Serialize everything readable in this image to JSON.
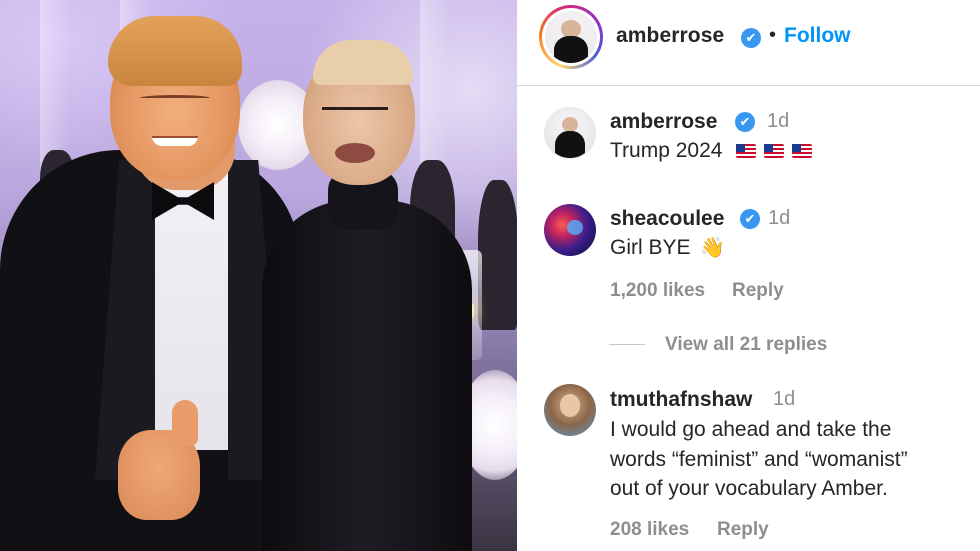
{
  "header": {
    "username": "amberrose",
    "verified_mark": "✔",
    "separator": "•",
    "follow_label": "Follow"
  },
  "comments": [
    {
      "username": "amberrose",
      "verified_mark": "✔",
      "time": "1d",
      "text": "Trump 2024",
      "emoji": "us-flag-icon x3"
    },
    {
      "username": "sheacoulee",
      "verified_mark": "✔",
      "time": "1d",
      "text": "Girl BYE",
      "emoji": "waving-hand-icon",
      "emoji_glyph": "👋",
      "likes": "1,200 likes",
      "reply_label": "Reply"
    },
    {
      "username": "tmuthafnshaw",
      "time": "1d",
      "text_lines": [
        "I would go ahead and take the",
        "words “feminist” and “womanist”",
        "out of your vocabulary Amber."
      ],
      "likes": "208 likes",
      "reply_label": "Reply"
    }
  ],
  "replies": {
    "view_label": "View all 21 replies"
  },
  "colors": {
    "accent": "#0095f6",
    "verified": "#3897f0",
    "muted": "#8e8e8e",
    "text": "#262626"
  }
}
